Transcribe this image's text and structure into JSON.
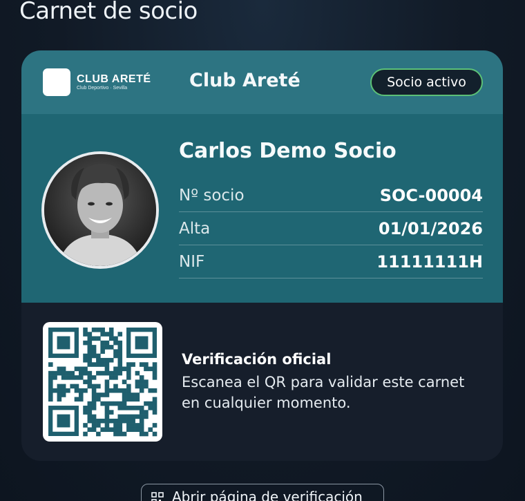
{
  "page": {
    "title": "Carnet de socio"
  },
  "card": {
    "logo": {
      "name": "CLUB ARETÉ",
      "subtitle": "Club Deportivo · Sevilla"
    },
    "club_name": "Club Areté",
    "status": "Socio activo",
    "member": {
      "name": "Carlos Demo Socio",
      "fields": [
        {
          "label": "Nº socio",
          "value": "SOC-00004"
        },
        {
          "label": "Alta",
          "value": "01/01/2026"
        },
        {
          "label": "NIF",
          "value": "11111111H"
        }
      ]
    },
    "verification": {
      "title": "Verificación oficial",
      "text": "Escanea el QR para validar este carnet en cualquier momento."
    }
  },
  "actions": {
    "open_verification": "Abrir página de verificación"
  },
  "colors": {
    "header": "#2d7482",
    "body": "#1f6673",
    "card_dark": "#161e2b",
    "status_border": "#5cc177",
    "qr_modules": "#1f5f6e"
  }
}
